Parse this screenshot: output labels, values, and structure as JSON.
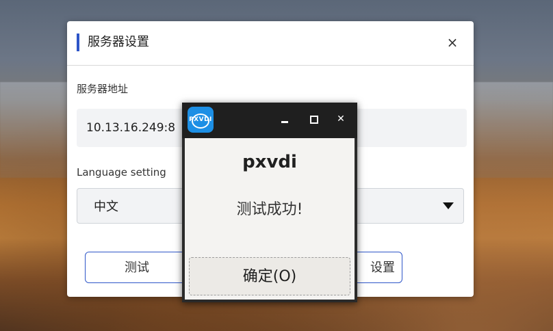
{
  "dialog": {
    "title": "服务器设置",
    "close_glyph": "×",
    "server_label": "服务器地址",
    "server_value": "10.13.16.249:8",
    "language_label": "Language setting",
    "language_value": "中文",
    "test_button": "测试",
    "save_button": "设置"
  },
  "popup": {
    "app_icon_text": "PXVDI",
    "close_glyph": "✕",
    "heading": "pxvdi",
    "message": "测试成功!",
    "ok_button": "确定(O)"
  },
  "colors": {
    "accent": "#2d55c8",
    "popup_titlebar": "#1f1f1f",
    "app_icon": "#1d8fe5"
  },
  "icons": [
    "close-icon",
    "chevron-down-icon",
    "minimize-icon",
    "maximize-icon",
    "close-icon",
    "pxvdi-logo-icon"
  ]
}
